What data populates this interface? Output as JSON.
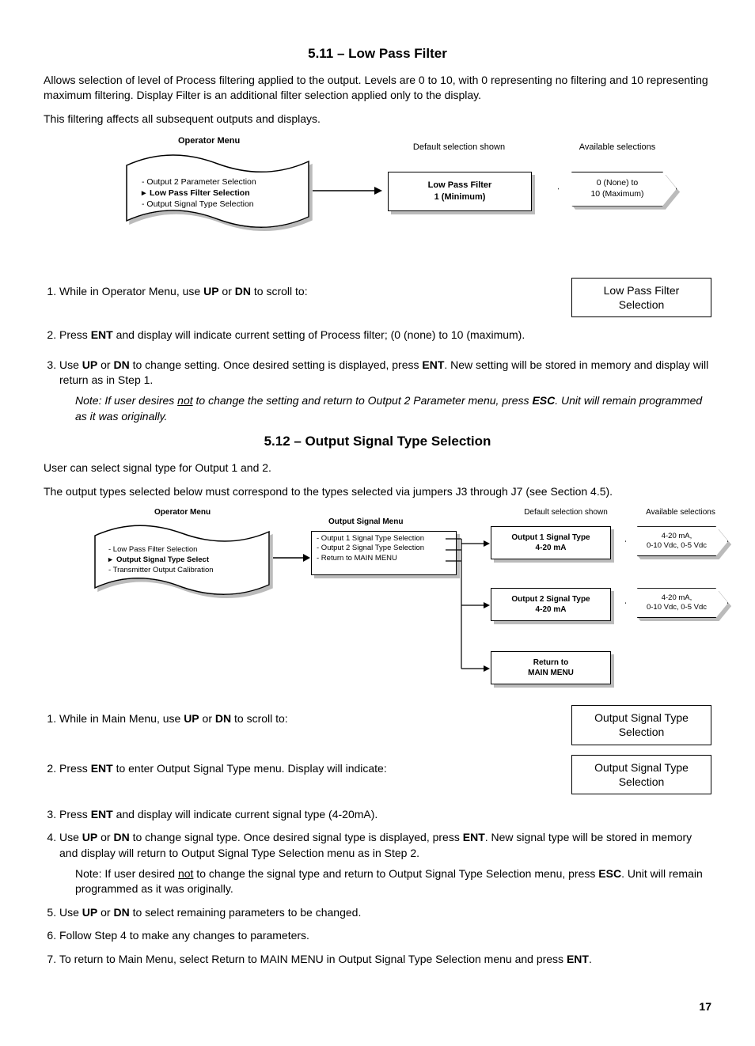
{
  "section511": {
    "title": "5.11 – Low Pass Filter",
    "intro1": "Allows selection of level of Process filtering applied to the output.  Levels are 0 to 10, with 0 representing no filtering and 10 representing maximum filtering.  Display Filter is an additional filter selection applied only to the display.",
    "intro2": "This filtering affects all subsequent outputs and displays.",
    "diagram": {
      "menu_title": "Operator Menu",
      "menu_items": [
        "- Output 2 Parameter Selection",
        "Low Pass Filter Selection",
        "- Output Signal Type Selection"
      ],
      "default_label": "Default selection shown",
      "default_box_l1": "Low Pass Filter",
      "default_box_l2": "1 (Minimum)",
      "avail_label": "Available selections",
      "avail_box_l1": "0 (None) to",
      "avail_box_l2": "10 (Maximum)"
    },
    "step1_a": "While in Operator Menu, use ",
    "step1_b": " or ",
    "step1_c": " to scroll to:",
    "k_up": "UP",
    "k_dn": "DN",
    "callout1_l1": "Low Pass Filter",
    "callout1_l2": "Selection",
    "step2_a": "Press ",
    "step2_b": " and display will indicate current setting of Process filter; (0 (none) to 10 (maximum).",
    "k_ent": "ENT",
    "step3_a": "Use ",
    "step3_b": " or ",
    "step3_c": " to change setting. Once desired setting is displayed, press ",
    "step3_d": ". New setting will be stored in memory and display will return as in Step 1.",
    "note_a": "Note: If user desires ",
    "note_not": "not",
    "note_b": " to change the setting and return to Output 2 Parameter menu, press ",
    "k_esc": "ESC",
    "note_c": ". Unit will remain programmed as it was originally."
  },
  "section512": {
    "title": "5.12 – Output Signal Type Selection",
    "intro1": "User can select signal type for Output 1 and 2.",
    "intro2": "The output types selected below must correspond to the types selected via jumpers J3 through J7 (see Section 4.5).",
    "diagram": {
      "menu_title": "Operator Menu",
      "menu_items": [
        "- Low Pass Filter Selection",
        "Output Signal Type Select",
        "- Transmitter Output Calibration"
      ],
      "sigmenu_title": "Output Signal Menu",
      "sigmenu_items": [
        "- Output 1 Signal Type Selection",
        "- Output 2 Signal Type Selection",
        "- Return to MAIN MENU"
      ],
      "default_label": "Default selection shown",
      "out1_l1": "Output 1 Signal Type",
      "out1_l2": "4-20 mA",
      "out2_l1": "Output 2 Signal Type",
      "out2_l2": "4-20 mA",
      "ret_l1": "Return to",
      "ret_l2": "MAIN MENU",
      "avail_label": "Available selections",
      "avail_l1": "4-20 mA,",
      "avail_l2": "0-10 Vdc, 0-5 Vdc"
    },
    "step1_a": "While in Main Menu, use ",
    "step1_b": " or ",
    "step1_c": " to scroll to:",
    "callout1_l1": "Output Signal Type",
    "callout1_l2": "Selection",
    "step2_a": "Press ",
    "step2_b": " to enter Output Signal Type menu. Display will indicate:",
    "callout2_l1": "Output Signal Type",
    "callout2_l2": "Selection",
    "step3_a": "Press ",
    "step3_b": " and display will indicate current signal type (4-20mA).",
    "step4_a": "Use ",
    "step4_b": " or ",
    "step4_c": " to change signal type. Once desired signal type is displayed, press ",
    "step4_d": ". New signal type will be stored in memory and display will return to Output Signal Type Selection menu as in Step 2.",
    "note_a": "Note: If user desired ",
    "note_not": "not",
    "note_b": " to change the signal type and return to Output Signal Type Selection menu, press ",
    "note_c": ". Unit will remain programmed as it was originally.",
    "step5_a": "Use ",
    "step5_b": " or ",
    "step5_c": " to select remaining parameters to be changed.",
    "step6": "Follow Step 4 to make any changes to parameters.",
    "step7_a": "To return to Main Menu, select Return to MAIN MENU in Output Signal Type Selection menu and press ",
    "step7_b": "."
  },
  "page_number": "17"
}
